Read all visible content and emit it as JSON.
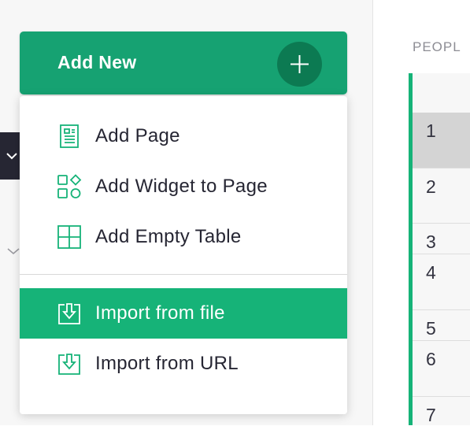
{
  "add_new": {
    "label": "Add New",
    "icon": "plus-icon"
  },
  "menu": {
    "items": [
      {
        "label": "Add Page",
        "icon": "page-icon"
      },
      {
        "label": "Add Widget to Page",
        "icon": "widget-icon"
      },
      {
        "label": "Add Empty Table",
        "icon": "table-icon"
      }
    ],
    "import_items": [
      {
        "label": "Import from file",
        "icon": "import-icon",
        "active": true
      },
      {
        "label": "Import from URL",
        "icon": "import-icon",
        "active": false
      }
    ]
  },
  "grid": {
    "title": "PEOPL",
    "rows": [
      "1",
      "2",
      "3",
      "4",
      "5",
      "6",
      "7"
    ],
    "selected_row": "1"
  },
  "colors": {
    "accent": "#16b378",
    "button": "#16a272",
    "button_circle": "#0c7a52",
    "dark_panel": "#262633"
  }
}
